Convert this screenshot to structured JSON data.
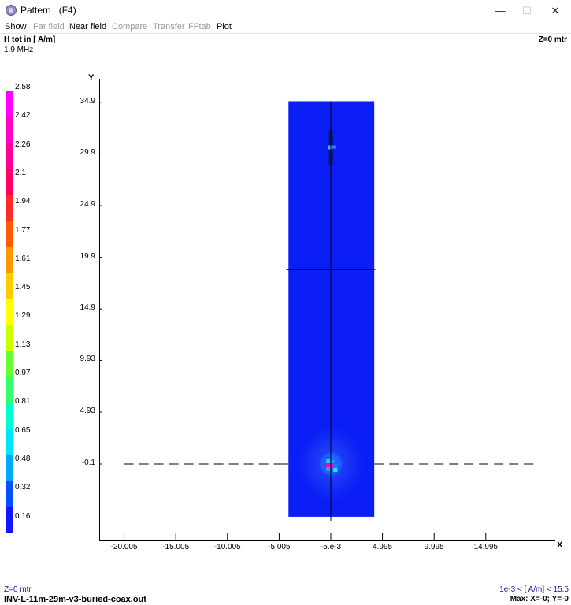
{
  "window": {
    "title": "Pattern",
    "shortcut": "(F4)",
    "minimize_glyph": "—",
    "maximize_glyph": "☐",
    "close_glyph": "✕"
  },
  "menu": [
    {
      "label": "Show",
      "enabled": true
    },
    {
      "label": "Far field",
      "enabled": false
    },
    {
      "label": "Near field",
      "enabled": true
    },
    {
      "label": "Compare",
      "enabled": false
    },
    {
      "label": "Transfer",
      "enabled": false
    },
    {
      "label": "FFtab",
      "enabled": false
    },
    {
      "label": "Plot",
      "enabled": true
    }
  ],
  "header": {
    "quantity": "H tot in [ A/m]",
    "frequency": "1.9 MHz",
    "z_plane": "Z=0 mtr"
  },
  "colors": {
    "field_background": "#0a1ef5",
    "axis": "#000000",
    "footer_text": "#1a1a9a"
  },
  "chart_data": {
    "type": "heatmap",
    "title": "H tot in [ A/m]",
    "subtitle": "1.9 MHz",
    "xlabel": "X",
    "ylabel": "Y",
    "x_tick_labels": [
      "-20.005",
      "-15.005",
      "-10.005",
      "-5.005",
      "-5.e-3",
      "4.995",
      "9.995",
      "14.995"
    ],
    "x_ticks": [
      -20.005,
      -15.005,
      -10.005,
      -5.005,
      -0.005,
      4.995,
      9.995,
      14.995
    ],
    "y_tick_labels": [
      "34.9",
      "29.9",
      "24.9",
      "19.9",
      "14.9",
      "9.93",
      "4.93",
      "-0.1"
    ],
    "y_ticks": [
      34.9,
      29.9,
      24.9,
      19.9,
      14.9,
      9.93,
      4.93,
      -0.1
    ],
    "field_extent": {
      "x": [
        -4.1,
        4.2
      ],
      "y": [
        -5.2,
        35.0
      ]
    },
    "wire_vertical_x": -0.005,
    "wire_vertical_y": [
      -5.6,
      35.0
    ],
    "wire_horizontal_y": 18.7,
    "wire_horizontal_x": [
      -4.3,
      4.3
    ],
    "ground_dashed_y": -0.1,
    "ground_dashed_x": [
      -20.0,
      20.0
    ],
    "hotspots": [
      {
        "x": 0.0,
        "y": -0.1,
        "value": 2.58,
        "label": "max"
      },
      {
        "x": 0.0,
        "y": 30.5,
        "value": 0.6
      }
    ],
    "background_value": 0.1,
    "colorbar": {
      "labels": [
        "2.58",
        "2.42",
        "2.26",
        "2.1",
        "1.94",
        "1.77",
        "1.61",
        "1.45",
        "1.29",
        "1.13",
        "0.97",
        "0.81",
        "0.65",
        "0.48",
        "0.32",
        "0.16"
      ],
      "colors": [
        "#ff00ff",
        "#ff00c8",
        "#ff0096",
        "#ff0064",
        "#ff2a28",
        "#ff5a00",
        "#ff9600",
        "#ffcc00",
        "#ffff00",
        "#ccff00",
        "#66ff33",
        "#33ff66",
        "#00ffcc",
        "#00e6ff",
        "#00aaff",
        "#0050ff",
        "#1414ff"
      ]
    },
    "range_text": "1e-3 < [ A/m] < 15.5",
    "max_text": "Max: X=-0; Y=-0"
  },
  "footer": {
    "z_plane": "Z=0 mtr",
    "file_name": "INV-L-11m-29m-v3-buried-coax.out",
    "range": "1e-3 < [ A/m] < 15.5",
    "max": "Max: X=-0; Y=-0"
  }
}
